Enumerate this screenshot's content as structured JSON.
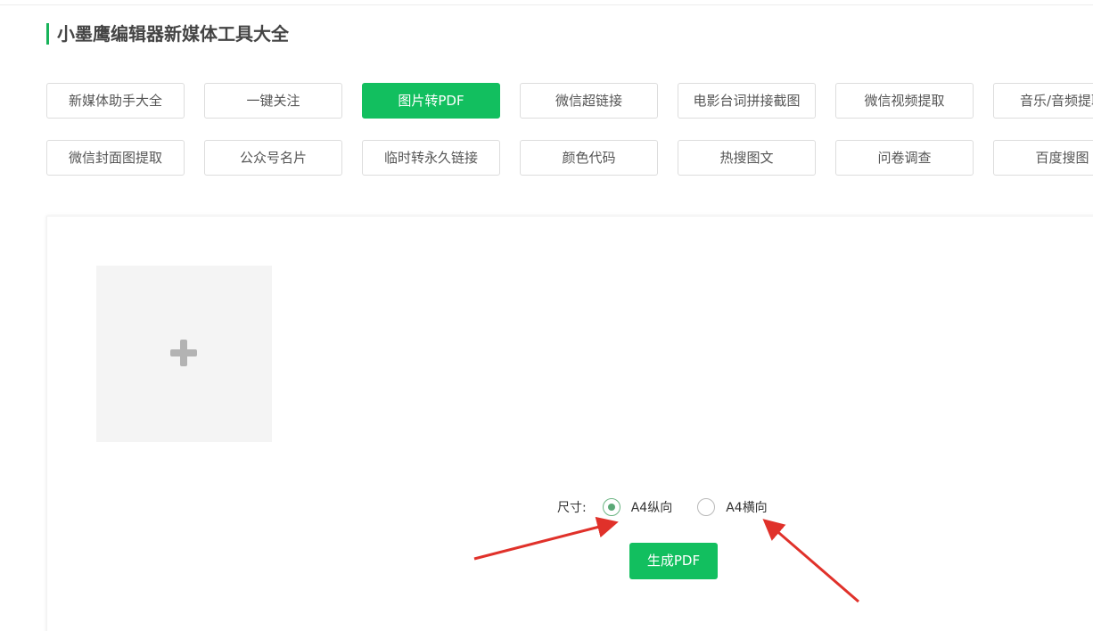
{
  "page": {
    "title": "小墨鹰编辑器新媒体工具大全"
  },
  "tools": {
    "row1": [
      {
        "label": "新媒体助手大全",
        "active": false
      },
      {
        "label": "一键关注",
        "active": false
      },
      {
        "label": "图片转PDF",
        "active": true
      },
      {
        "label": "微信超链接",
        "active": false
      },
      {
        "label": "电影台词拼接截图",
        "active": false
      },
      {
        "label": "微信视频提取",
        "active": false
      },
      {
        "label": "音乐/音频提取",
        "active": false
      }
    ],
    "row2": [
      {
        "label": "微信封面图提取",
        "active": false
      },
      {
        "label": "公众号名片",
        "active": false
      },
      {
        "label": "临时转永久链接",
        "active": false
      },
      {
        "label": "颜色代码",
        "active": false
      },
      {
        "label": "热搜图文",
        "active": false
      },
      {
        "label": "问卷调查",
        "active": false
      },
      {
        "label": "百度搜图",
        "active": false
      }
    ]
  },
  "converter": {
    "upload_icon": "plus-icon",
    "size_label": "尺寸:",
    "options": [
      {
        "label": "A4纵向",
        "checked": true
      },
      {
        "label": "A4横向",
        "checked": false
      }
    ],
    "generate_label": "生成PDF"
  },
  "colors": {
    "accent": "#12bf5f",
    "annotation_arrow": "#e0312a"
  }
}
